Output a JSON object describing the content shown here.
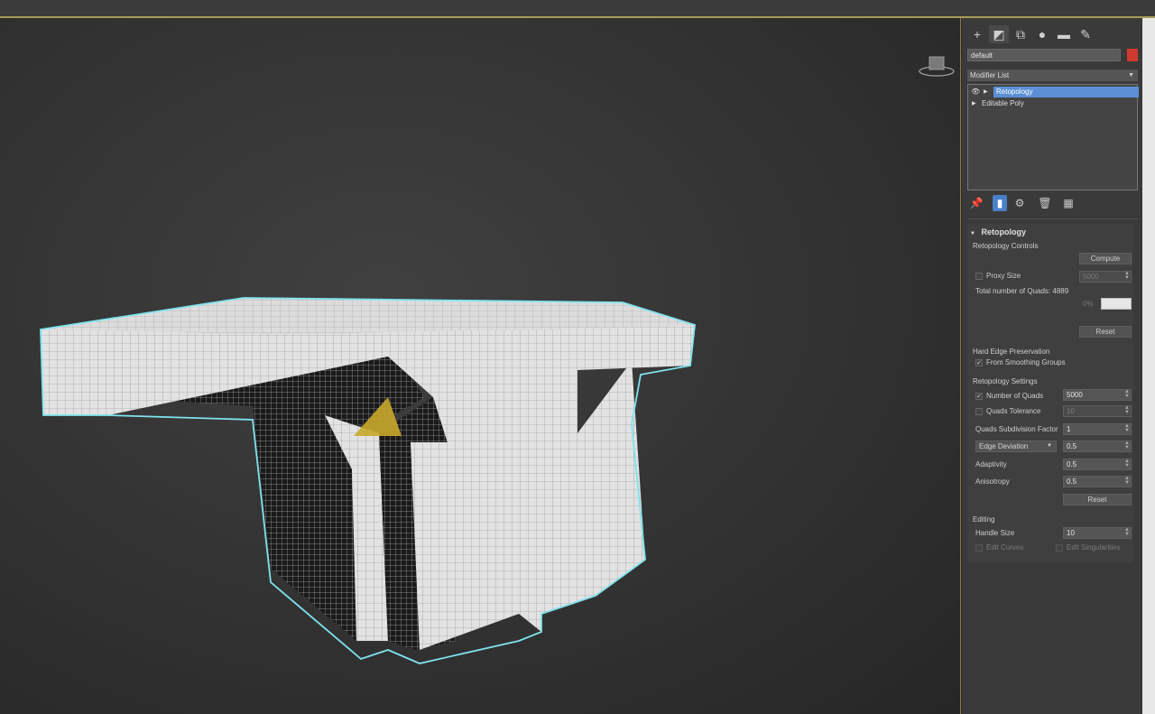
{
  "name_field": "default",
  "accent_color": "#d03a2e",
  "modifier_list": {
    "label": "Modifier List"
  },
  "stack": [
    {
      "label": "Retopology",
      "selected": true
    },
    {
      "label": "Editable Poly",
      "selected": false
    }
  ],
  "tabs": [
    "create-icon",
    "modify-icon",
    "hierarchy-icon",
    "motion-icon",
    "display-icon",
    "utilities-icon"
  ],
  "retopology": {
    "title": "Retopology",
    "controls_label": "Retopology Controls",
    "compute": "Compute",
    "proxy_size_label": "Proxy Size",
    "proxy_size_value": "5000",
    "total_quads": "Total number of Quads: 4889",
    "progress_text": "0%",
    "reset": "Reset",
    "hard_edge_label": "Hard Edge Preservation",
    "from_smoothing": "From Smoothing Groups",
    "settings_label": "Retopology Settings",
    "num_quads_label": "Number of Quads",
    "num_quads_value": "5000",
    "quads_tol_label": "Quads Tolerance",
    "quads_tol_value": "10",
    "subdiv_label": "Quads Subdivision Factor",
    "subdiv_value": "1",
    "edge_dev_label": "Edge Deviation",
    "edge_dev_value": "0.5",
    "adaptivity_label": "Adaptivity",
    "adaptivity_value": "0.5",
    "anisotropy_label": "Anisotropy",
    "anisotropy_value": "0.5",
    "reset2": "Reset"
  },
  "editing": {
    "label": "Editing",
    "handle_size_label": "Handle Size",
    "handle_size_value": "10",
    "edit_curves": "Edit Curves",
    "edit_singularities": "Edit Singularities"
  }
}
